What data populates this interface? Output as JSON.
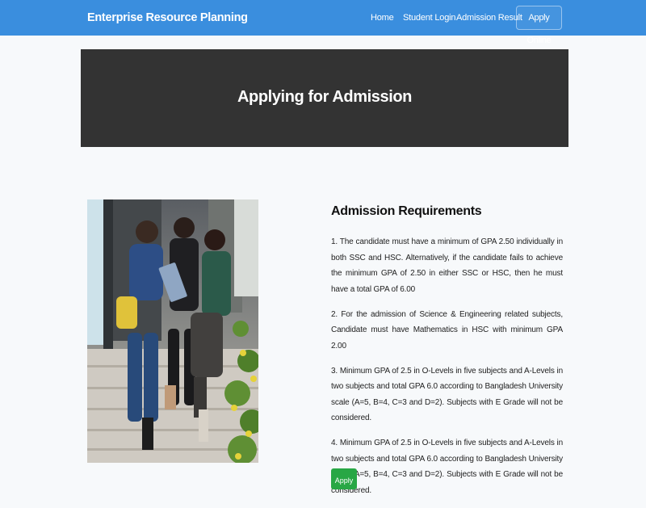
{
  "navbar": {
    "brand": "Enterprise Resource Planning",
    "links": [
      "Home",
      "Student Login",
      "Admission Result"
    ],
    "apply_online": "Apply Online"
  },
  "hero": {
    "title": "Applying for Admission"
  },
  "requirements": {
    "title": "Admission Requirements",
    "items": [
      "1. The candidate must have a minimum of GPA 2.50 individually in both SSC and HSC. Alternatively, if the candidate fails to achieve the minimum GPA of 2.50 in either SSC or HSC, then he must have a total GPA of 6.00",
      "2. For the admission of Science & Engineering related subjects, Candidate must have Mathematics in HSC with minimum GPA 2.00",
      "3. Minimum GPA of 2.5 in O-Levels in five subjects and A-Levels in two subjects and total GPA 6.0 according to Bangladesh University scale (A=5, B=4, C=3 and D=2). Subjects with E Grade will not be considered.",
      "4. Minimum GPA of 2.5 in O-Levels in five subjects and A-Levels in two subjects and total GPA 6.0 according to Bangladesh University scale (A=5, B=4, C=3 and D=2). Subjects with E Grade will not be considered."
    ]
  },
  "apply_button": "Apply",
  "colors": {
    "navbar": "#3a8ede",
    "hero": "#333333",
    "apply": "#28a745",
    "page_bg": "#f7f9fb"
  },
  "image": {
    "subject": "Three students sitting on campus steps, one holding a laptop"
  }
}
